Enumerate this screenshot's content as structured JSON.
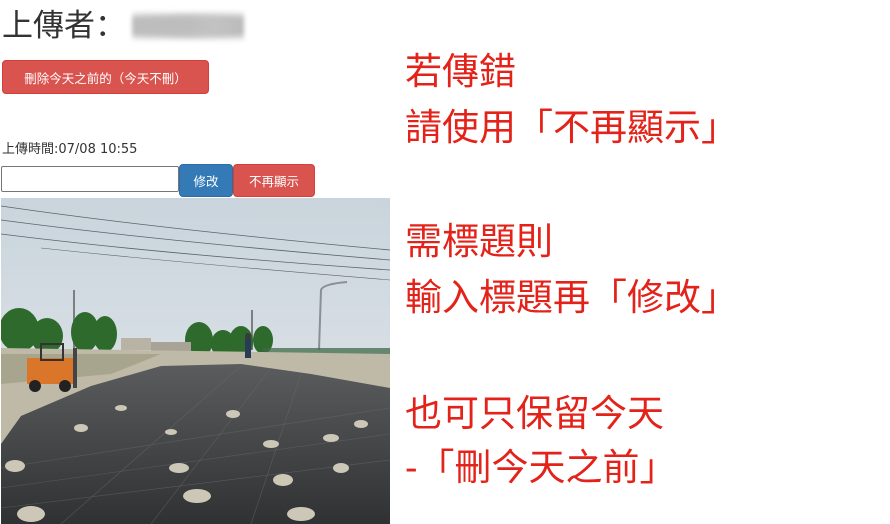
{
  "uploader": {
    "label": "上傳者："
  },
  "buttons": {
    "delete_before": "刪除今天之前的（今天不刪）",
    "edit": "修改",
    "hide": "不再顯示"
  },
  "upload_time": "上傳時間:07/08 10:55",
  "title_input": {
    "value": "",
    "placeholder": ""
  },
  "instructions": [
    "若傳錯",
    "請使用「不再顯示」",
    "需標題則",
    "輸入標題再「修改」",
    "也可只保留今天",
    "-「刪今天之前」"
  ],
  "colors": {
    "danger": "#d9534f",
    "primary": "#337ab7",
    "annotation": "#e32219"
  }
}
